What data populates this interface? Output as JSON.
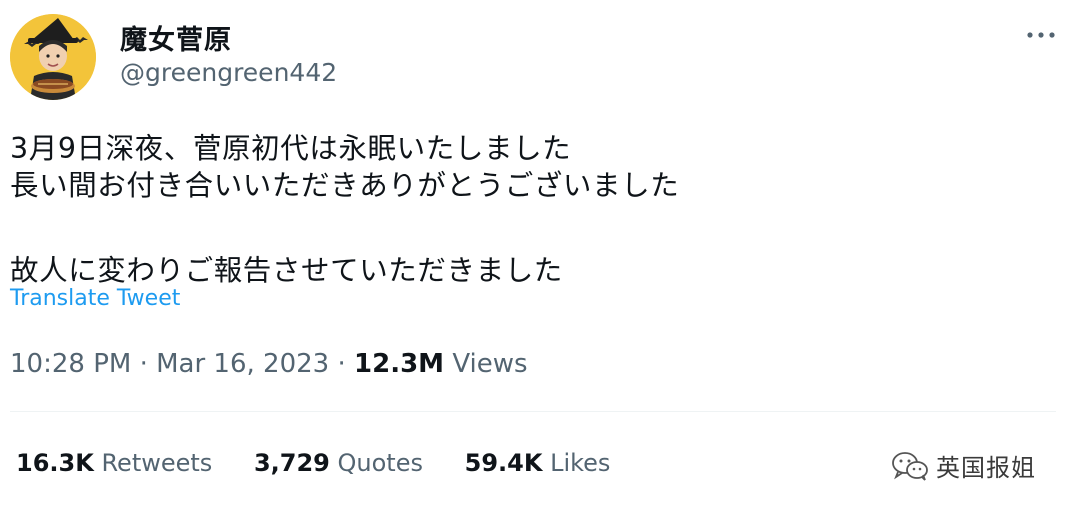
{
  "author": {
    "display_name": "魔女菅原",
    "handle": "@greengreen442",
    "avatar_icon": "witch-avatar-icon"
  },
  "more_icon": "more-horizontal-icon",
  "tweet": {
    "lines": [
      "3月9日深夜、菅原初代は永眠いたしました",
      "長い間お付き合いいただきありがとうございました",
      "故人に変わりご報告させていただきました"
    ],
    "translate_label": "Translate Tweet"
  },
  "meta": {
    "time": "10:28 PM",
    "separator": "·",
    "date": "Mar 16, 2023",
    "views_count": "12.3M",
    "views_label": "Views"
  },
  "stats": {
    "retweets": {
      "count": "16.3K",
      "label": "Retweets"
    },
    "quotes": {
      "count": "3,729",
      "label": "Quotes"
    },
    "likes": {
      "count": "59.4K",
      "label": "Likes"
    }
  },
  "watermark": {
    "text": "英国报姐",
    "icon": "wechat-icon"
  },
  "colors": {
    "link_blue": "#1d9bf0",
    "secondary_text": "#536471",
    "primary_text": "#0f1419",
    "divider": "#eff3f4"
  }
}
